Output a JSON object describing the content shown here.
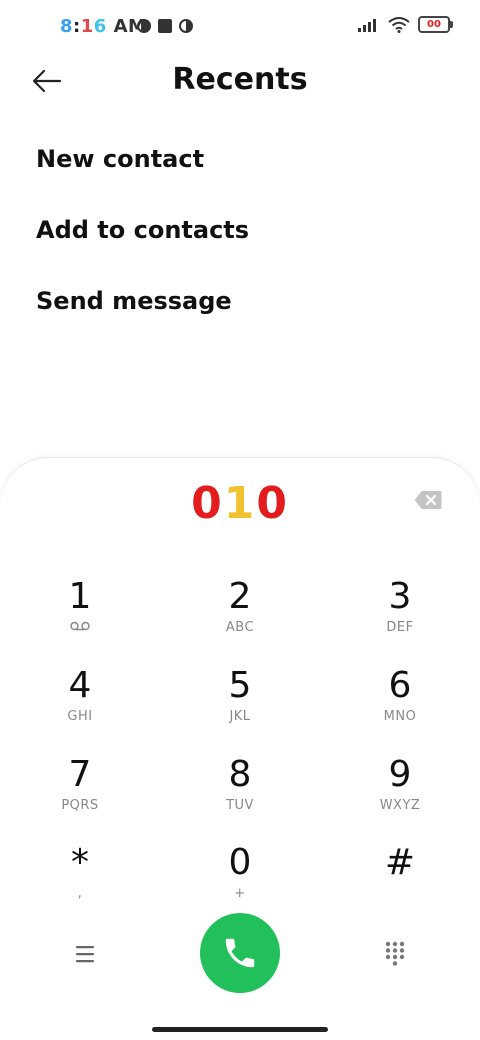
{
  "status_bar": {
    "time_parts": [
      "8",
      ":",
      "1",
      "6"
    ],
    "ampm": "AM",
    "battery_label": "00"
  },
  "header": {
    "title": "Recents"
  },
  "menu": {
    "items": [
      {
        "label": "New contact"
      },
      {
        "label": "Add to contacts"
      },
      {
        "label": "Send message"
      }
    ]
  },
  "dialer": {
    "number_digits": [
      "0",
      "1",
      "0"
    ],
    "keys": [
      {
        "digit": "1",
        "letters": ""
      },
      {
        "digit": "2",
        "letters": "ABC"
      },
      {
        "digit": "3",
        "letters": "DEF"
      },
      {
        "digit": "4",
        "letters": "GHI"
      },
      {
        "digit": "5",
        "letters": "JKL"
      },
      {
        "digit": "6",
        "letters": "MNO"
      },
      {
        "digit": "7",
        "letters": "PQRS"
      },
      {
        "digit": "8",
        "letters": "TUV"
      },
      {
        "digit": "9",
        "letters": "WXYZ"
      },
      {
        "digit": "*",
        "letters": ","
      },
      {
        "digit": "0",
        "letters": "+"
      },
      {
        "digit": "#",
        "letters": ""
      }
    ]
  },
  "colors": {
    "call_button": "#22c05a",
    "digit_red": "#e31d1d",
    "digit_yellow": "#f2c12e"
  }
}
